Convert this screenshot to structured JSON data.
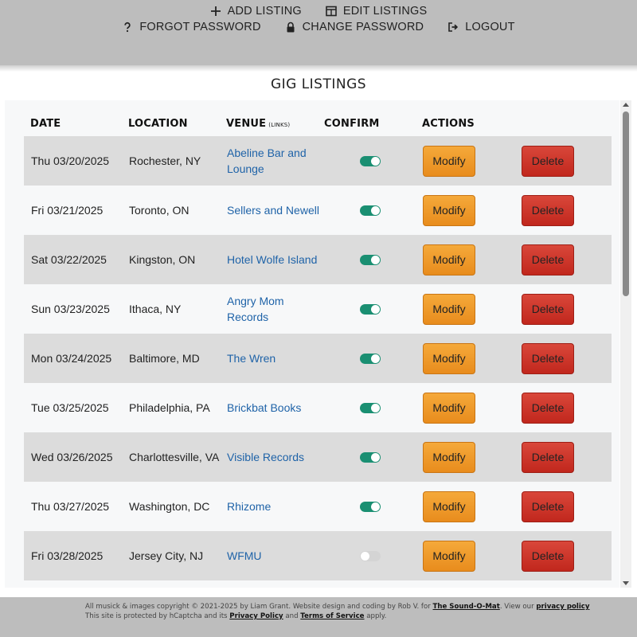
{
  "nav": {
    "add_listing": "ADD LISTING",
    "edit_listings": "EDIT LISTINGS",
    "forgot_password": "FORGOT PASSWORD",
    "change_password": "CHANGE PASSWORD",
    "logout": "LOGOUT"
  },
  "icons": {
    "add": "plus-icon",
    "edit": "table-icon",
    "forgot": "question-icon",
    "change": "lock-icon",
    "logout": "logout-icon"
  },
  "page_title": "GIG LISTINGS",
  "columns": {
    "date": "DATE",
    "location": "LOCATION",
    "venue": "VENUE",
    "venue_note": "(LINKS)",
    "confirm": "CONFIRM",
    "actions": "ACTIONS"
  },
  "rows": [
    {
      "date": "Thu 03/20/2025",
      "location": "Rochester, NY",
      "venue": "Abeline Bar and Lounge",
      "confirmed": true,
      "modify": "Modify",
      "delete": "Delete"
    },
    {
      "date": "Fri 03/21/2025",
      "location": "Toronto, ON",
      "venue": "Sellers and Newell",
      "confirmed": true,
      "modify": "Modify",
      "delete": "Delete"
    },
    {
      "date": "Sat 03/22/2025",
      "location": "Kingston, ON",
      "venue": "Hotel Wolfe Island",
      "confirmed": true,
      "modify": "Modify",
      "delete": "Delete"
    },
    {
      "date": "Sun 03/23/2025",
      "location": "Ithaca, NY",
      "venue": "Angry Mom Records",
      "confirmed": true,
      "modify": "Modify",
      "delete": "Delete"
    },
    {
      "date": "Mon 03/24/2025",
      "location": "Baltimore, MD",
      "venue": "The Wren",
      "confirmed": true,
      "modify": "Modify",
      "delete": "Delete"
    },
    {
      "date": "Tue 03/25/2025",
      "location": "Philadelphia, PA",
      "venue": "Brickbat Books",
      "confirmed": true,
      "modify": "Modify",
      "delete": "Delete"
    },
    {
      "date": "Wed 03/26/2025",
      "location": "Charlottesville, VA",
      "venue": "Visible Records",
      "confirmed": true,
      "modify": "Modify",
      "delete": "Delete"
    },
    {
      "date": "Thu 03/27/2025",
      "location": "Washington, DC",
      "venue": "Rhizome",
      "confirmed": true,
      "modify": "Modify",
      "delete": "Delete"
    },
    {
      "date": "Fri 03/28/2025",
      "location": "Jersey City, NJ",
      "venue": "WFMU",
      "confirmed": false,
      "modify": "Modify",
      "delete": "Delete"
    }
  ],
  "footer": {
    "line1_prefix": "All musick & images copyright © 2021-2025 by Liam Grant. Website design and coding by Rob V. for ",
    "sound_o_mat": "The Sound-O-Mat",
    "line1_mid": ". View our ",
    "privacy_policy_link": "privacy policy",
    "line2_prefix": "This site is protected by hCaptcha and its ",
    "hcaptcha_privacy": "Privacy Policy",
    "line2_and": " and ",
    "terms": "Terms of Service",
    "line2_suffix": " apply."
  },
  "colors": {
    "header_bg": "#bdbdbd",
    "toggle_on": "#1a8f72",
    "toggle_off": "#d4d4d4",
    "modify": "#ef9a2a",
    "delete": "#cd3428",
    "link": "#1f63a8"
  }
}
